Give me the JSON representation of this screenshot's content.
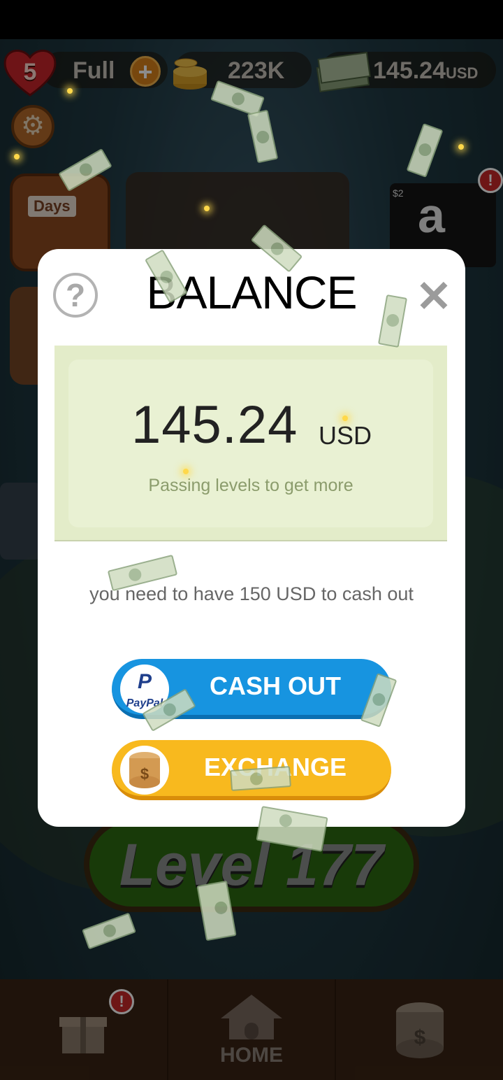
{
  "hud": {
    "lives": "5",
    "lives_status": "Full",
    "coins": "223K",
    "cash_amount": "145.24",
    "cash_unit": "USD"
  },
  "side": {
    "days_label": "Days",
    "amazon_letter": "a",
    "amazon_value": "$2",
    "alert_badge": "!"
  },
  "level_button": {
    "label": "Level 177"
  },
  "bottom_nav": {
    "home_label": "HOME",
    "gift_badge": "!"
  },
  "dialog": {
    "title": "BALANCE",
    "help_icon": "?",
    "close_icon": "✕",
    "amount": "145.24",
    "currency": "USD",
    "hint": "Passing levels to get more",
    "cashout_note": "you need to have 150 USD to cash out",
    "cashout_label": "CASH OUT",
    "paypal_text": "PayPal",
    "exchange_label": "EXCHANGE"
  },
  "colors": {
    "cashout_blue": "#1794e0",
    "exchange_yellow": "#f8b91e",
    "card_green": "#e3ecc9",
    "hint_green": "#8b9c6c"
  }
}
